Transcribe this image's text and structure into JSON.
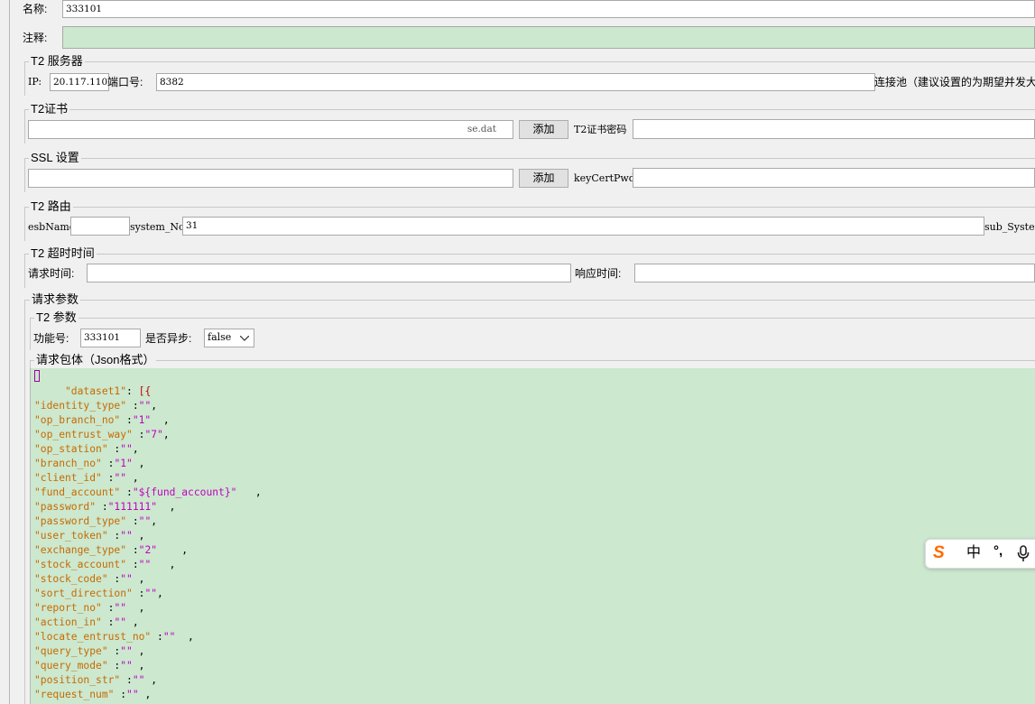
{
  "name_row": {
    "label": "名称:",
    "value": "333101"
  },
  "comment_row": {
    "label": "注释:",
    "value": ""
  },
  "server": {
    "legend": "T2 服务器",
    "ip_label": "IP:",
    "ip_value": "20.117.110",
    "port_label": "端口号:",
    "port_value": "8382",
    "pool_label": "连接池（建议设置的为期望并发大"
  },
  "cert": {
    "legend": "T2证书",
    "path_value": "D:\\...\\性能测试工具\\...\\client_license.dat",
    "path_tail": "se.dat",
    "add_button": "添加",
    "pwd_label": "T2证书密码",
    "pwd_value": ""
  },
  "ssl": {
    "legend": "SSL 设置",
    "path_value": "",
    "add_button": "添加",
    "pwd_label": "keyCertPwd",
    "pwd_value": ""
  },
  "route": {
    "legend": "T2 路由",
    "esb_label": "esbName",
    "esb_value": "",
    "system_label": "system_No",
    "system_value": "31",
    "sub_label": "sub_Systen"
  },
  "timeout": {
    "legend": "T2 超时时间",
    "req_label": "请求时间:",
    "req_value": "",
    "resp_label": "响应时间:",
    "resp_value": ""
  },
  "params": {
    "legend": "请求参数",
    "t2_legend": "T2 参数",
    "func_label": "功能号:",
    "func_value": "333101",
    "async_label": "是否异步:",
    "async_value": "false"
  },
  "body": {
    "legend": "请求包体（Json格式）",
    "lines": [
      {
        "k": "",
        "v": "",
        "t": "open"
      },
      {
        "k": "     \"dataset1\"",
        "v": "[{",
        "t": "ds"
      },
      {
        "k": "\"identity_type\"",
        "sep": " :",
        "v": "\"\"",
        "tail": ","
      },
      {
        "k": "\"op_branch_no\"",
        "sep": " :",
        "v": "\"1\"",
        "tail": "  ,"
      },
      {
        "k": "\"op_entrust_way\"",
        "sep": " :",
        "v": "\"7\"",
        "tail": ","
      },
      {
        "k": "\"op_station\"",
        "sep": " :",
        "v": "\"\"",
        "tail": ","
      },
      {
        "k": "\"branch_no\"",
        "sep": " :",
        "v": "\"1\"",
        "tail": " ,"
      },
      {
        "k": "\"client_id\"",
        "sep": " :",
        "v": "\"\"",
        "tail": " ,"
      },
      {
        "k": "\"fund_account\"",
        "sep": " :",
        "v": "\"${fund_account}\"",
        "tail": "   ,"
      },
      {
        "k": "\"password\"",
        "sep": " :",
        "v": "\"111111\"",
        "tail": "  ,"
      },
      {
        "k": "\"password_type\"",
        "sep": " :",
        "v": "\"\"",
        "tail": ","
      },
      {
        "k": "\"user_token\"",
        "sep": " :",
        "v": "\"\"",
        "tail": " ,"
      },
      {
        "k": "\"exchange_type\"",
        "sep": " :",
        "v": "\"2\"",
        "tail": "    ,"
      },
      {
        "k": "\"stock_account\"",
        "sep": " :",
        "v": "\"\"",
        "tail": "   ,"
      },
      {
        "k": "\"stock_code\"",
        "sep": " :",
        "v": "\"\"",
        "tail": " ,"
      },
      {
        "k": "\"sort_direction\"",
        "sep": " :",
        "v": "\"\"",
        "tail": ","
      },
      {
        "k": "\"report_no\"",
        "sep": " :",
        "v": "\"\"",
        "tail": "  ,"
      },
      {
        "k": "\"action_in\"",
        "sep": " :",
        "v": "\"\"",
        "tail": " ,"
      },
      {
        "k": "\"locate_entrust_no\"",
        "sep": " :",
        "v": "\"\"",
        "tail": "  ,"
      },
      {
        "k": "\"query_type\"",
        "sep": " :",
        "v": "\"\"",
        "tail": " ,"
      },
      {
        "k": "\"query_mode\"",
        "sep": " :",
        "v": "\"\"",
        "tail": " ,"
      },
      {
        "k": "\"position_str\"",
        "sep": " :",
        "v": "\"\"",
        "tail": " ,"
      },
      {
        "k": "\"request_num\"",
        "sep": " :",
        "v": "\"\"",
        "tail": " ,"
      }
    ]
  },
  "ime": {
    "logo": "S",
    "mode": "中",
    "punct": "°,",
    "mic": "mic-icon"
  },
  "colors": {
    "editor_bg": "#cce8cf",
    "key": "#c76a00",
    "string": "#c000c0",
    "brace": "#c00000"
  }
}
